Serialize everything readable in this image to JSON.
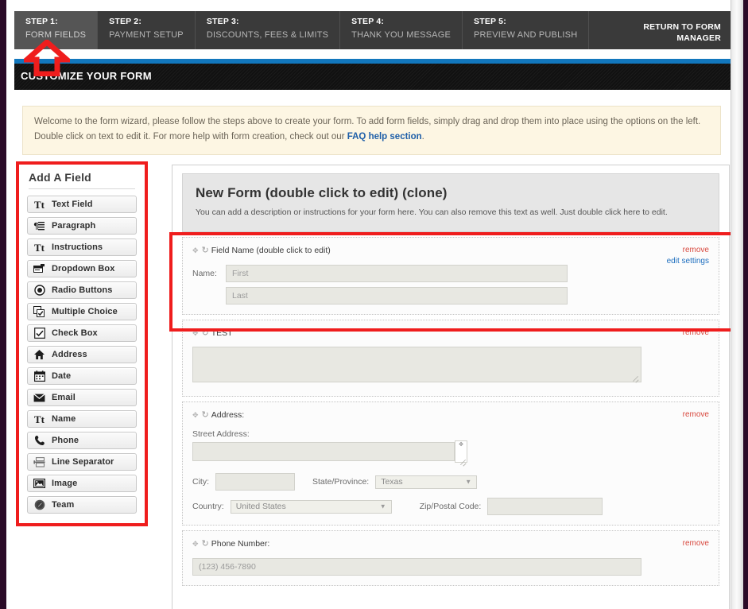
{
  "nav": {
    "steps": [
      {
        "num": "STEP 1:",
        "label": "FORM FIELDS",
        "active": true
      },
      {
        "num": "STEP 2:",
        "label": "PAYMENT SETUP",
        "active": false
      },
      {
        "num": "STEP 3:",
        "label": "DISCOUNTS, FEES & LIMITS",
        "active": false
      },
      {
        "num": "STEP 4:",
        "label": "THANK YOU MESSAGE",
        "active": false
      },
      {
        "num": "STEP 5:",
        "label": "PREVIEW AND PUBLISH",
        "active": false
      }
    ],
    "return_line1": "RETURN TO FORM",
    "return_line2": "MANAGER"
  },
  "banner": {
    "title": "CUSTOMIZE YOUR FORM",
    "accent_blue": "#1277bd"
  },
  "notice": {
    "text_before": "Welcome to the form wizard, please follow the steps above to create your form. To add form fields, simply drag and drop them into place using the options on the left. Double click on text to edit it. For more help with form creation, check out our ",
    "link_text": "FAQ help section",
    "text_after": ".",
    "background": "#fdf6e3"
  },
  "sidebar": {
    "title": "Add A Field",
    "items": [
      {
        "label": "Text Field",
        "icon": "text-tt-icon"
      },
      {
        "label": "Paragraph",
        "icon": "paragraph-icon"
      },
      {
        "label": "Instructions",
        "icon": "text-tt-icon"
      },
      {
        "label": "Dropdown Box",
        "icon": "dropdown-box-icon"
      },
      {
        "label": "Radio Buttons",
        "icon": "radio-button-icon"
      },
      {
        "label": "Multiple Choice",
        "icon": "multiple-choice-icon"
      },
      {
        "label": "Check Box",
        "icon": "check-box-icon"
      },
      {
        "label": "Address",
        "icon": "home-icon"
      },
      {
        "label": "Date",
        "icon": "calendar-icon"
      },
      {
        "label": "Email",
        "icon": "envelope-icon"
      },
      {
        "label": "Name",
        "icon": "text-tt-icon"
      },
      {
        "label": "Phone",
        "icon": "phone-icon"
      },
      {
        "label": "Line Separator",
        "icon": "line-separator-icon"
      },
      {
        "label": "Image",
        "icon": "image-icon"
      },
      {
        "label": "Team",
        "icon": "team-icon"
      }
    ],
    "highlight_color": "#ef1d1d"
  },
  "form": {
    "title": "New Form (double click to edit) (clone)",
    "description": "You can add a description or instructions for your form here. You can also remove this text as well. Just double click here to edit.",
    "actions": {
      "remove": "remove",
      "edit_settings": "edit settings"
    },
    "fields": [
      {
        "title": "Field Name (double click to edit)",
        "name_label": "Name:",
        "first_placeholder": "First",
        "last_placeholder": "Last",
        "has_edit_settings": true
      },
      {
        "title": "TEST",
        "textarea_value": ""
      },
      {
        "title": "Address:",
        "street_label": "Street Address:",
        "city_label": "City:",
        "state_label": "State/Province:",
        "state_value": "Texas",
        "country_label": "Country:",
        "country_value": "United States",
        "zip_label": "Zip/Postal Code:",
        "city_value": "",
        "zip_value": ""
      },
      {
        "title": "Phone Number:",
        "phone_placeholder": "(123) 456-7890"
      }
    ]
  },
  "annotations": {
    "arrow_color": "#ef1d1d",
    "highlight_color": "#ef1d1d"
  }
}
